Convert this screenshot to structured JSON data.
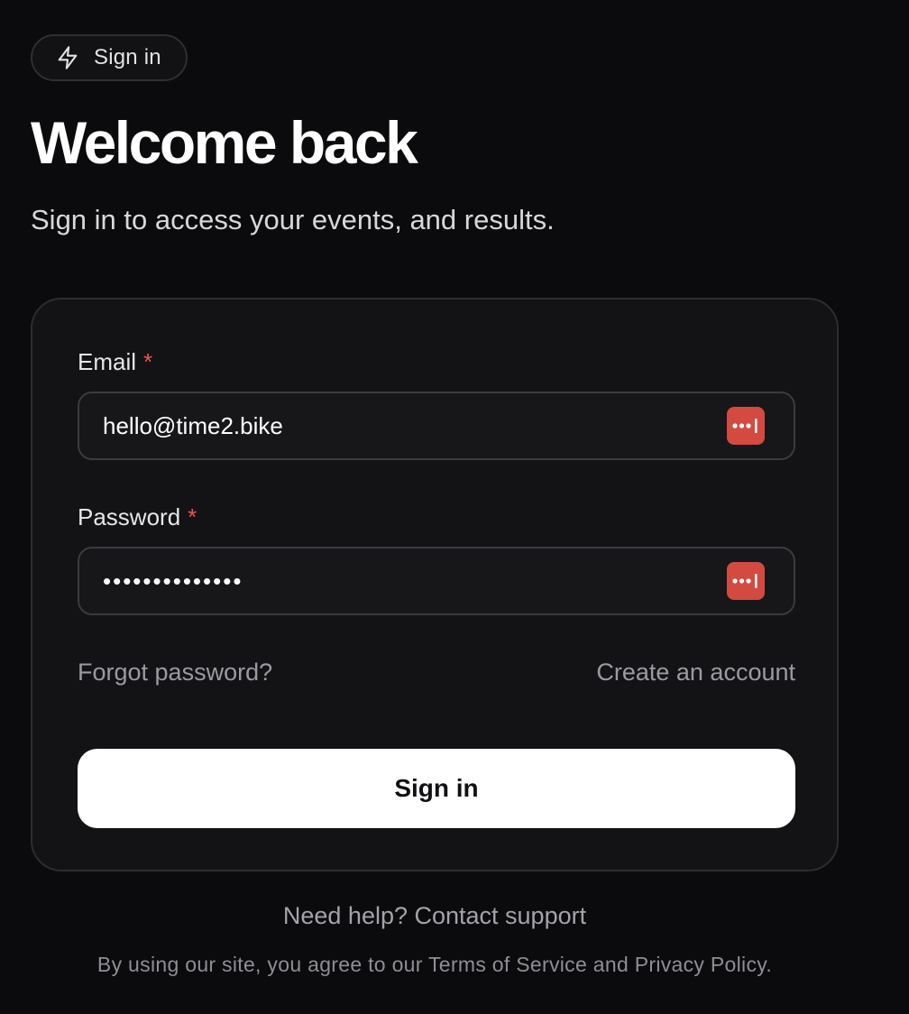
{
  "badge": {
    "label": "Sign in",
    "icon": "lightning-icon"
  },
  "header": {
    "title": "Welcome back",
    "subtitle": "Sign in to access your events, and results."
  },
  "form": {
    "email": {
      "label": "Email",
      "required_mark": "*",
      "value": "hello@time2.bike",
      "icon": "password-manager-icon"
    },
    "password": {
      "label": "Password",
      "required_mark": "*",
      "value": "••••••••••••••",
      "icon": "password-manager-icon"
    },
    "forgot_password": "Forgot password?",
    "create_account": "Create an account",
    "submit_label": "Sign in"
  },
  "footer": {
    "help": "Need help? Contact support",
    "legal": "By using our site, you agree to our Terms of Service and Privacy Policy."
  },
  "colors": {
    "background": "#0b0b0d",
    "card": "#131316",
    "required": "#ef5350",
    "password_manager": "#d24a40",
    "button": "#ffffff"
  }
}
